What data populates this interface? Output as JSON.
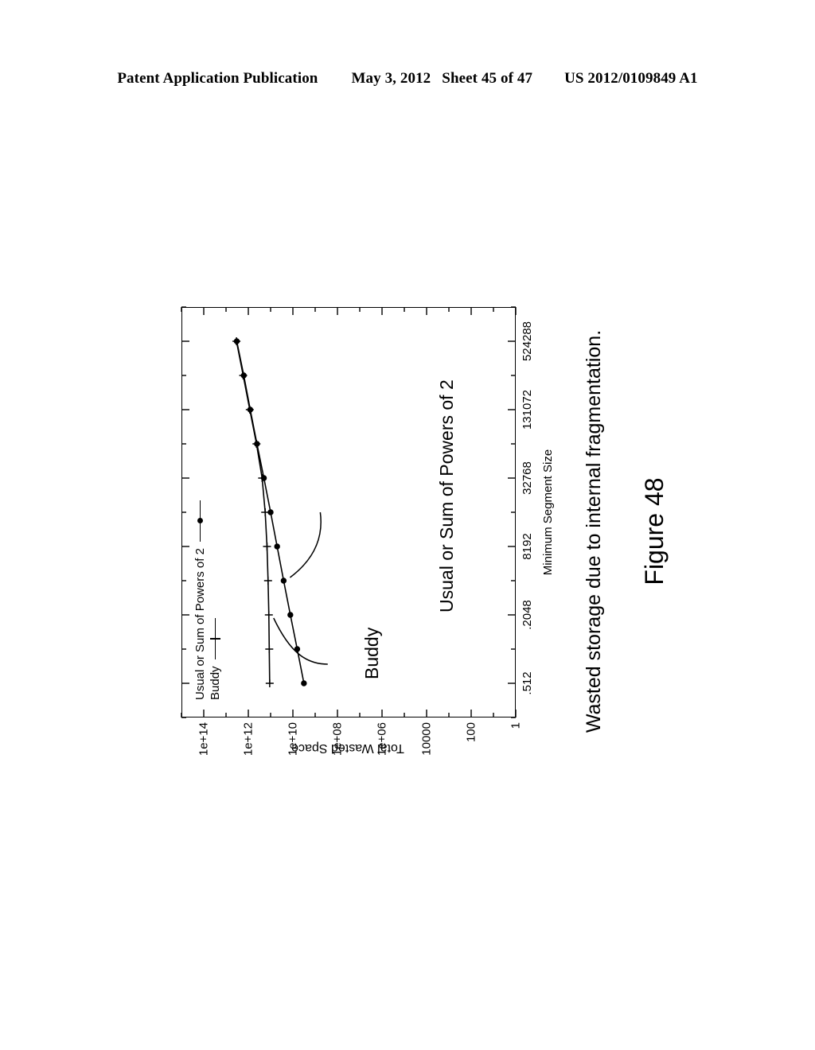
{
  "header": {
    "publication": "Patent Application Publication",
    "date": "May 3, 2012",
    "sheet": "Sheet 45 of 47",
    "patent_number": "US 2012/0109849 A1"
  },
  "figure": {
    "caption": "Wasted storage due to internal fragmentation.",
    "number": "Figure 48"
  },
  "annotations": {
    "buddy": "Buddy",
    "usual": "Usual or Sum of Powers of 2"
  },
  "chart_data": {
    "type": "line",
    "title": "",
    "xlabel": "Minimum Segment Size",
    "ylabel": "Total Wasted Space",
    "xscale": "log",
    "yscale": "log",
    "xlim": [
      256,
      1048576
    ],
    "ylim": [
      1,
      1000000000000000.0
    ],
    "xtick_labels": [
      ".512",
      ".2048",
      "8192",
      "32768",
      "131072",
      "524288"
    ],
    "xtick_values": [
      512,
      2048,
      8192,
      32768,
      131072,
      524288
    ],
    "ytick_labels": [
      "1",
      "100",
      "10000",
      "1e+06",
      "1e+08",
      "1e+10",
      "1e+12",
      "1e+14"
    ],
    "ytick_values": [
      1,
      100,
      10000,
      1000000,
      100000000,
      10000000000,
      1000000000000,
      100000000000000
    ],
    "grid": false,
    "legend_position": "top-left",
    "series": [
      {
        "name": "Usual or Sum of Powers of 2",
        "marker": "dot",
        "x": [
          512,
          1024,
          2048,
          4096,
          8192,
          16384,
          32768,
          65536,
          131072,
          262144,
          524288
        ],
        "y": [
          3200000000.0,
          6400000000.0,
          13000000000.0,
          26000000000.0,
          51000000000.0,
          100000000000.0,
          200000000000.0,
          410000000000.0,
          820000000000.0,
          1600000000000.0,
          3300000000000.0
        ]
      },
      {
        "name": "Buddy",
        "marker": "plus",
        "x": [
          512,
          1024,
          2048,
          4096,
          8192,
          16384,
          32768,
          65536,
          131072,
          262144,
          524288
        ],
        "y": [
          110000000000.0,
          115000000000.0,
          120000000000.0,
          130000000000.0,
          145000000000.0,
          175000000000.0,
          240000000000.0,
          430000000000.0,
          860000000000.0,
          1700000000000.0,
          3400000000000.0
        ]
      }
    ]
  }
}
